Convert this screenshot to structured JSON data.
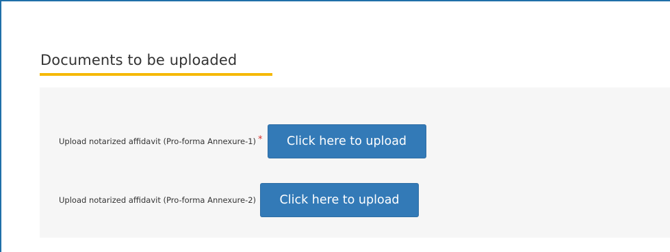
{
  "section": {
    "title": "Documents to be uploaded"
  },
  "colors": {
    "frame_border": "#1f6fa8",
    "underline_accent": "#f5b800",
    "button_bg": "#337ab7",
    "required_mark": "#d9302c",
    "panel_bg": "#f6f6f6"
  },
  "uploads": [
    {
      "label": "Upload notarized affidavit (Pro-forma Annexure-1)",
      "required_mark": "*",
      "button_label": "Click here to upload"
    },
    {
      "label": "Upload notarized affidavit (Pro-forma Annexure-2)",
      "button_label": "Click here to upload"
    }
  ]
}
